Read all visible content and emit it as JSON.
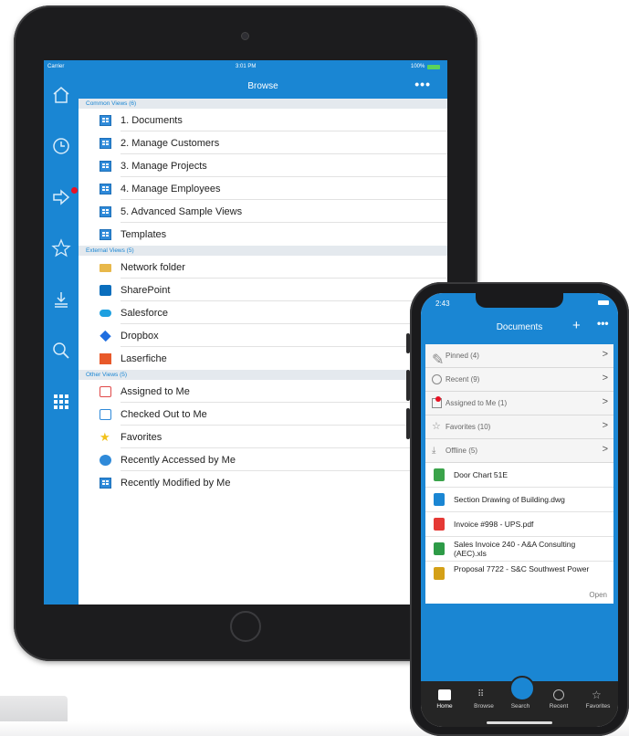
{
  "tablet": {
    "status": {
      "carrier": "Carrier",
      "time": "3:01 PM",
      "battery": "100%"
    },
    "nav": {
      "title": "Browse",
      "more": "•••"
    },
    "sections": [
      {
        "title": "Common Views (6)",
        "items": [
          {
            "label": "1. Documents",
            "icon": "view-grid-icon"
          },
          {
            "label": "2. Manage Customers",
            "icon": "view-grid-icon"
          },
          {
            "label": "3. Manage Projects",
            "icon": "view-grid-icon"
          },
          {
            "label": "4. Manage Employees",
            "icon": "view-grid-icon"
          },
          {
            "label": "5. Advanced Sample Views",
            "icon": "view-grid-icon"
          },
          {
            "label": "Templates",
            "icon": "view-grid-icon"
          }
        ]
      },
      {
        "title": "External Views (5)",
        "items": [
          {
            "label": "Network folder",
            "icon": "folder-icon"
          },
          {
            "label": "SharePoint",
            "icon": "sharepoint-icon"
          },
          {
            "label": "Salesforce",
            "icon": "salesforce-icon"
          },
          {
            "label": "Dropbox",
            "icon": "dropbox-icon"
          },
          {
            "label": "Laserfiche",
            "icon": "laserfiche-icon"
          }
        ]
      },
      {
        "title": "Other Views (5)",
        "items": [
          {
            "label": "Assigned to Me",
            "icon": "assigned-icon"
          },
          {
            "label": "Checked Out to Me",
            "icon": "checked-out-icon"
          },
          {
            "label": "Favorites",
            "icon": "star-icon"
          },
          {
            "label": "Recently Accessed by Me",
            "icon": "clock-icon"
          },
          {
            "label": "Recently Modified by Me",
            "icon": "view-grid-icon"
          }
        ]
      }
    ],
    "sidebar_icons": [
      "home-icon",
      "recent-icon",
      "assigned-icon",
      "favorites-icon",
      "offline-icon",
      "search-icon",
      "browse-grid-icon"
    ],
    "colors": {
      "accent": "#1a86d3",
      "section_bg": "#e4e9ee"
    }
  },
  "phone": {
    "status": {
      "time": "2:43"
    },
    "nav": {
      "title": "Documents",
      "add": "+",
      "more": "•••"
    },
    "groups": [
      {
        "label": "Pinned (4)",
        "icon": "pin-icon"
      },
      {
        "label": "Recent (9)",
        "icon": "clock-icon"
      },
      {
        "label": "Assigned to Me (1)",
        "icon": "assigned-icon"
      },
      {
        "label": "Favorites (10)",
        "icon": "star-icon"
      },
      {
        "label": "Offline (5)",
        "icon": "offline-icon"
      }
    ],
    "files": [
      {
        "label": "Door Chart 51E",
        "icon": "file-green-icon",
        "color": "#3aa34a"
      },
      {
        "label": "Section Drawing of Building.dwg",
        "icon": "dwg-icon",
        "color": "#1a86d3"
      },
      {
        "label": "Invoice #998 - UPS.pdf",
        "icon": "pdf-icon",
        "color": "#e53935"
      },
      {
        "label": "Sales Invoice 240 - A&A Consulting (AEC).xls",
        "icon": "xls-icon",
        "color": "#2e9b47"
      },
      {
        "label": "Proposal 7722 - S&C Southwest Power",
        "icon": "books-icon",
        "color": "#d4a017"
      }
    ],
    "open_label": "Open",
    "tabs": [
      {
        "label": "Home",
        "icon": "home-icon"
      },
      {
        "label": "Browse",
        "icon": "browse-grid-icon"
      },
      {
        "label": "Search",
        "icon": "search-icon"
      },
      {
        "label": "Recent",
        "icon": "clock-icon"
      },
      {
        "label": "Favorites",
        "icon": "star-icon"
      }
    ]
  }
}
